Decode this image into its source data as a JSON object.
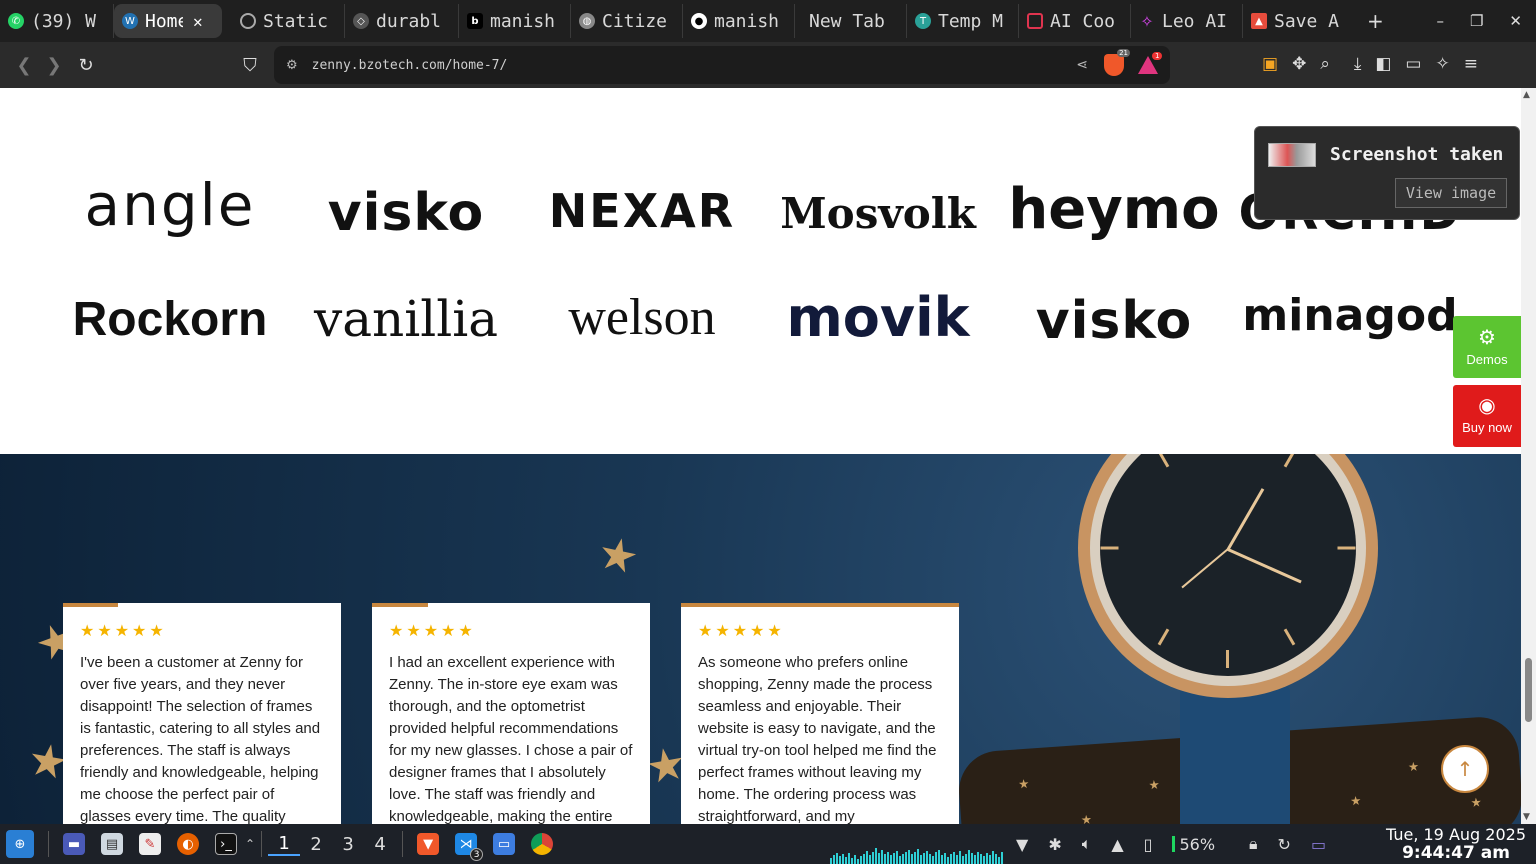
{
  "browser": {
    "tabs": [
      {
        "title": "(39) W",
        "icon": "whatsapp-icon",
        "color": "#25d366"
      },
      {
        "title": "Home",
        "icon": "wordpress-icon",
        "color": "#2271b1",
        "active": true
      },
      {
        "title": "Static",
        "icon": "openai-icon",
        "color": "#aaaaaa"
      },
      {
        "title": "durabl",
        "icon": "durable-icon",
        "color": "#888888"
      },
      {
        "title": "manish",
        "icon": "b-icon",
        "color": "#000000"
      },
      {
        "title": "Citize",
        "icon": "globe-icon",
        "color": "#888888"
      },
      {
        "title": "manish",
        "icon": "github-icon",
        "color": "#ffffff"
      },
      {
        "title": "New Tab",
        "icon": "",
        "color": ""
      },
      {
        "title": "Temp M",
        "icon": "temp-icon",
        "color": "#2aa198"
      },
      {
        "title": "AI Coo",
        "icon": "cube-icon",
        "color": "#e0344f"
      },
      {
        "title": "Leo AI",
        "icon": "leo-icon",
        "color": "#d946ef"
      },
      {
        "title": "Save A",
        "icon": "image-icon",
        "color": "#e74c3c"
      }
    ],
    "new_tab": "+",
    "window_buttons": [
      "–",
      "❐",
      "✕"
    ],
    "url": "zenny.bzotech.com/home-7/",
    "shield_count": "21",
    "rewards_count": "1"
  },
  "brands": {
    "row1": [
      "angle",
      "visko",
      "NEXAR",
      "Mosvolk",
      "heymo",
      "ORCHID"
    ],
    "row2": [
      "Rockorn",
      "vanillia",
      "welson",
      "movik",
      "visko",
      "minagod"
    ]
  },
  "testimonials": [
    {
      "stars": "★★★★★",
      "text": "I've been a customer at Zenny for over five years, and they never disappoint! The selection of frames is fantastic, catering to all styles and preferences. The staff is always friendly and knowledgeable, helping me choose the perfect pair of glasses every time. The quality"
    },
    {
      "stars": "★★★★★",
      "text": "I had an excellent experience with Zenny. The in-store eye exam was thorough, and the optometrist provided helpful recommendations for my new glasses. I chose a pair of designer frames that I absolutely love. The staff was friendly and knowledgeable, making the entire"
    },
    {
      "stars": "★★★★★",
      "text": "As someone who prefers online shopping, Zenny made the process seamless and enjoyable. Their website is easy to navigate, and the virtual try-on tool helped me find the perfect frames without leaving my home. The ordering process was straightforward, and my"
    }
  ],
  "side_buttons": {
    "demos": "Demos",
    "buy": "Buy now",
    "demos_color": "#5cc531",
    "buy_color": "#e01b1b"
  },
  "toast": {
    "message": "Screenshot taken",
    "button": "View image"
  },
  "taskbar": {
    "workspaces": [
      "1",
      "2",
      "3",
      "4"
    ],
    "current_workspace": "1",
    "vscode_badge": "3",
    "battery": "56%",
    "date": "Tue, 19 Aug 2025",
    "time": "9:44:47 am"
  }
}
